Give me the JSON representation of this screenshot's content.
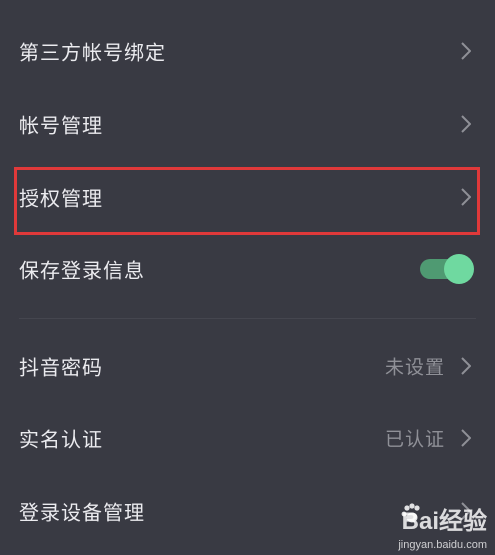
{
  "settings": {
    "items": [
      {
        "label": "第三方帐号绑定",
        "value": ""
      },
      {
        "label": "帐号管理",
        "value": ""
      },
      {
        "label": "授权管理",
        "value": ""
      },
      {
        "label": "保存登录信息",
        "value": ""
      },
      {
        "label": "抖音密码",
        "value": "未设置"
      },
      {
        "label": "实名认证",
        "value": "已认证"
      },
      {
        "label": "登录设备管理",
        "value": ""
      }
    ],
    "save_login_toggle": {
      "on": true
    }
  },
  "colors": {
    "background": "#393a43",
    "highlight_border": "#e0393a",
    "toggle_track": "#4f9a72",
    "toggle_knob": "#6fd9a0",
    "text_primary": "#ebebef",
    "text_secondary": "#8f9097"
  },
  "icons": {
    "chevron": "chevron-right-icon",
    "watermark": "baidu-paw-icon"
  },
  "watermark": {
    "logo_text": "Bai经验",
    "url": "jingyan.baidu.com"
  }
}
